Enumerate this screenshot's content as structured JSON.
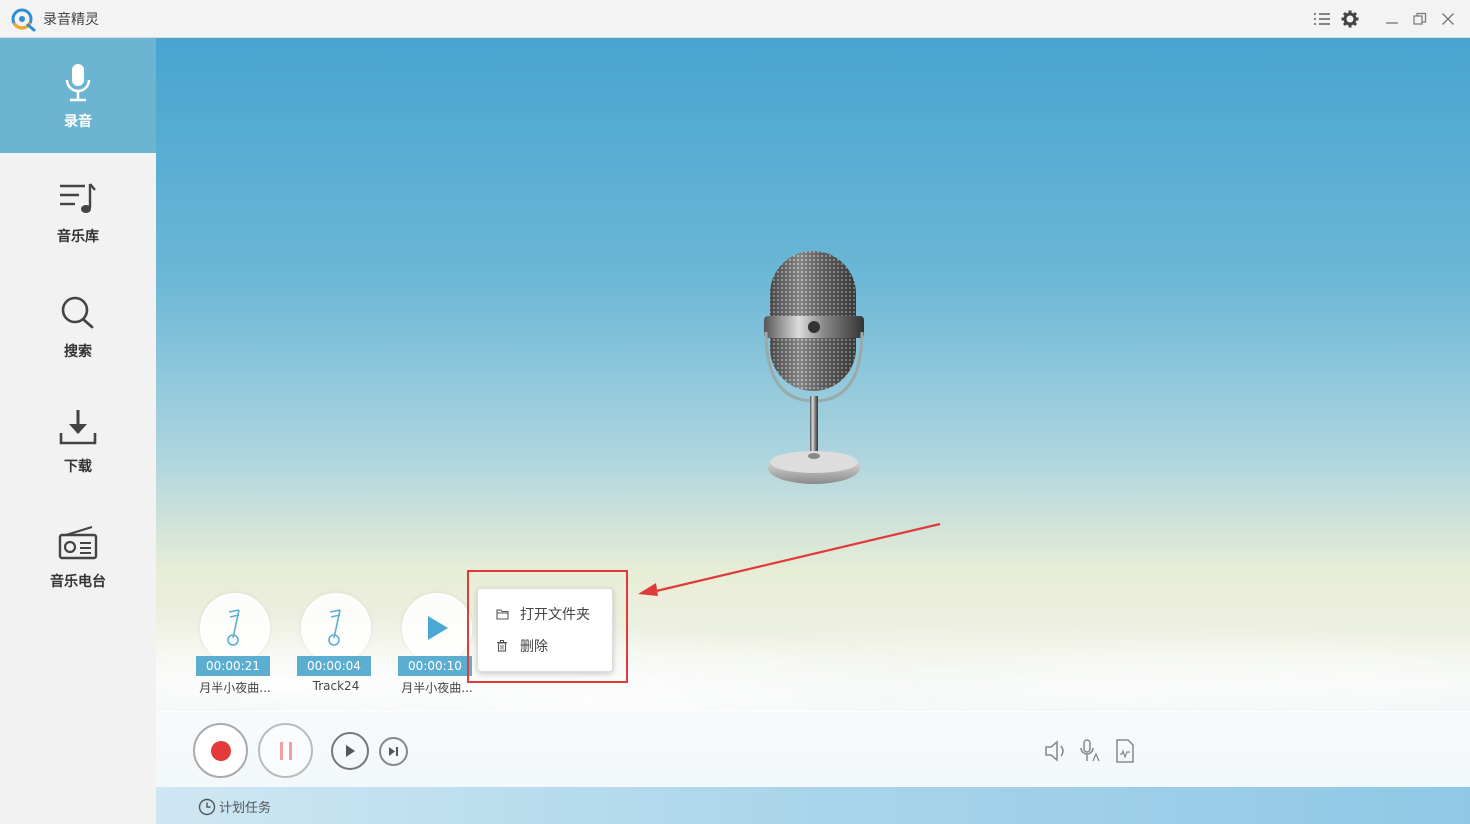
{
  "app": {
    "title": "录音精灵",
    "accent": "#6cb5d2",
    "record_color": "#e53a3a"
  },
  "sidebar": {
    "items": [
      {
        "label": "录音",
        "icon": "microphone-icon",
        "active": true
      },
      {
        "label": "音乐库",
        "icon": "music-list-icon",
        "active": false
      },
      {
        "label": "搜索",
        "icon": "search-icon",
        "active": false
      },
      {
        "label": "下载",
        "icon": "download-icon",
        "active": false
      },
      {
        "label": "音乐电台",
        "icon": "radio-icon",
        "active": false
      }
    ]
  },
  "tracks": [
    {
      "time": "00:00:21",
      "name": "月半小夜曲...",
      "icon": "music-note-icon"
    },
    {
      "time": "00:00:04",
      "name": "Track24",
      "icon": "music-note-icon"
    },
    {
      "time": "00:00:10",
      "name": "月半小夜曲...",
      "icon": "play-icon"
    }
  ],
  "context_menu": {
    "items": [
      {
        "label": "打开文件夹",
        "icon": "folder-icon"
      },
      {
        "label": "删除",
        "icon": "trash-icon"
      }
    ]
  },
  "bottom": {
    "schedule_label": "计划任务"
  }
}
